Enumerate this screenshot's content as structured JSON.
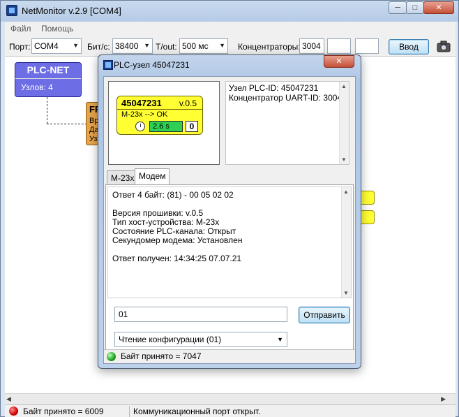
{
  "app": {
    "title": "NetMonitor v.2.9 [COM4]",
    "window_controls": {
      "minimize": "─",
      "maximize": "□",
      "close": "✕"
    }
  },
  "menu": {
    "items": [
      "Файл",
      "Помощь"
    ]
  },
  "toolbar": {
    "port_label": "Порт:",
    "port_value": "COM4",
    "baud_label": "Бит/с:",
    "baud_value": "38400",
    "timeout_label": "T/out:",
    "timeout_value": "500 мс",
    "concentrators_label": "Концентраторы:",
    "concentrators_value": "3004",
    "input_button": "Ввод",
    "camera_icon": "camera-icon"
  },
  "canvas": {
    "plc_net": {
      "title": "PLC-NET",
      "nodes": "Узлов: 4"
    },
    "orange_node": {
      "title": "FF",
      "lines": [
        "Вр",
        "Да",
        "Уз"
      ]
    }
  },
  "statusbar": {
    "bytes": "Байт принято = 6009",
    "message": "Коммуникационный порт открыт.",
    "led_color": "#d10000"
  },
  "dialog": {
    "title": "PLC-узел 45047231",
    "close": "✕",
    "card": {
      "id": "45047231",
      "version": "v.0.5",
      "status": "M-23x --> OK",
      "timer": "2.6 s",
      "counter": "0",
      "fill_color": "#ffff33"
    },
    "info_lines": [
      "Узел PLC-ID: 45047231",
      "Концентратор UART-ID: 3004"
    ],
    "tabs": [
      {
        "label": "M-23x",
        "active": false
      },
      {
        "label": "Модем",
        "active": true
      }
    ],
    "response_lines": [
      "Ответ 4 байт: (81) - 00 05 02 02",
      "",
      "Версия прошивки: v.0.5",
      "Тип хост-устройства: M-23x",
      "Состояние PLC-канала: Открыт",
      "Секундомер модема: Установлен",
      "",
      "Ответ получен: 14:34:25 07.07.21"
    ],
    "command_input": "01",
    "send_button": "Отправить",
    "command_select": "Чтение конфигурации (01)",
    "status": "Байт принято = 7047",
    "status_led_color": "#1ea01e"
  }
}
